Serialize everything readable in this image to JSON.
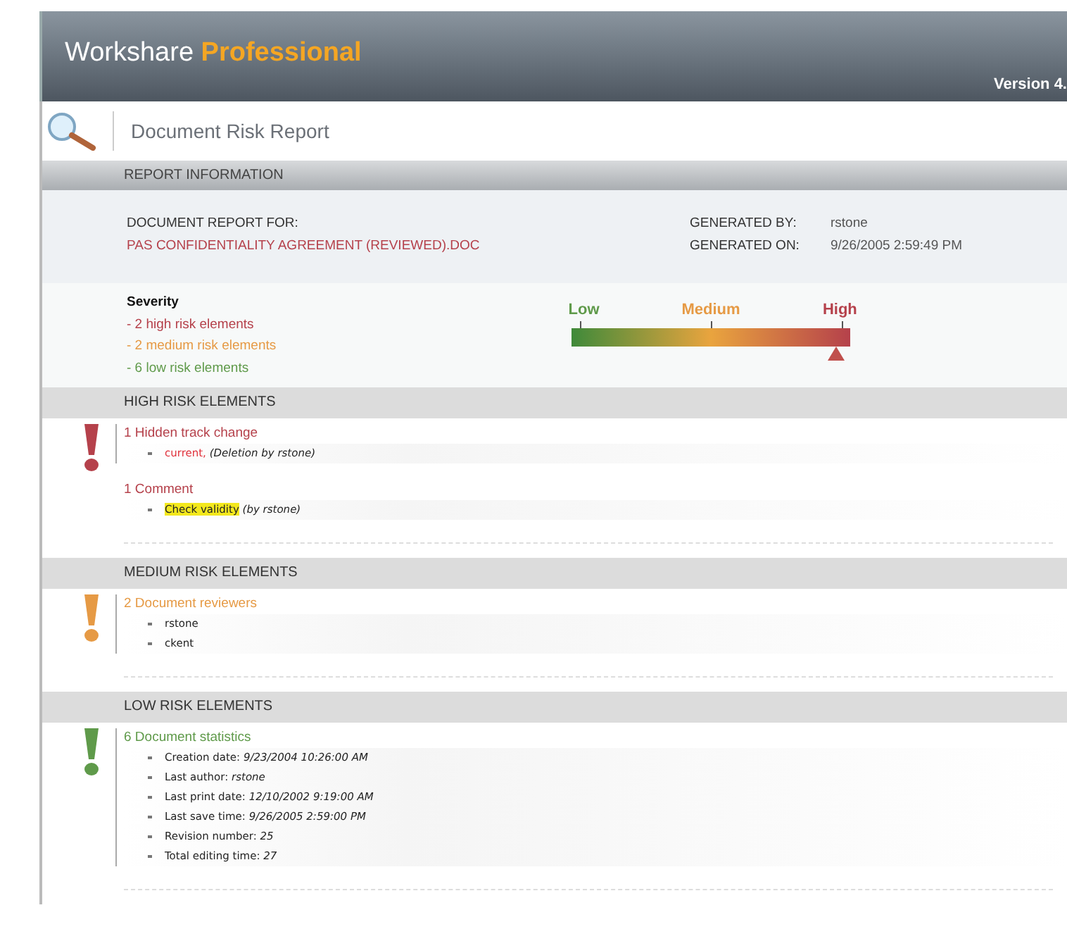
{
  "header": {
    "brand": "Workshare",
    "product": "Professional",
    "version": "Version 4."
  },
  "title": "Document Risk Report",
  "report_info": {
    "heading": "REPORT INFORMATION",
    "for_label": "DOCUMENT REPORT FOR:",
    "document": "PAS CONFIDENTIALITY AGREEMENT (REVIEWED).DOC",
    "by_label": "GENERATED BY:",
    "by": "rstone",
    "on_label": "GENERATED ON:",
    "on": "9/26/2005 2:59:49 PM"
  },
  "severity": {
    "heading": "Severity",
    "counts": [
      {
        "kind": "high",
        "text": "- 2 high risk elements"
      },
      {
        "kind": "medium",
        "text": "- 2 medium risk elements"
      },
      {
        "kind": "low",
        "text": "- 6 low risk elements"
      }
    ],
    "scale": [
      {
        "kind": "low",
        "label": "Low"
      },
      {
        "kind": "medium",
        "label": "Medium"
      },
      {
        "kind": "high",
        "label": "High"
      }
    ],
    "level": 0.95
  },
  "sections": [
    {
      "kind": "high",
      "heading": "HIGH RISK ELEMENTS",
      "groups": [
        {
          "title": "1 Hidden track change",
          "items": [
            {
              "kind": "deleted",
              "value": "current,",
              "note": "(Deletion by rstone)"
            }
          ]
        },
        {
          "title": "1 Comment",
          "items": [
            {
              "kind": "comment",
              "value": "Check validity",
              "note": "(by rstone)"
            }
          ]
        }
      ]
    },
    {
      "kind": "medium",
      "heading": "MEDIUM RISK ELEMENTS",
      "groups": [
        {
          "title": "2 Document reviewers",
          "items": [
            {
              "kind": "plain",
              "value": "rstone"
            },
            {
              "kind": "plain",
              "value": "ckent"
            }
          ]
        }
      ]
    },
    {
      "kind": "low",
      "heading": "LOW RISK ELEMENTS",
      "groups": [
        {
          "title": "6 Document statistics",
          "items": [
            {
              "kind": "stat",
              "label": "Creation date:",
              "value": "9/23/2004 10:26:00 AM"
            },
            {
              "kind": "stat",
              "label": "Last author:",
              "value": "rstone"
            },
            {
              "kind": "stat",
              "label": "Last print date:",
              "value": "12/10/2002 9:19:00 AM"
            },
            {
              "kind": "stat",
              "label": "Last save time:",
              "value": "9/26/2005 2:59:00 PM"
            },
            {
              "kind": "stat",
              "label": "Revision number:",
              "value": "25"
            },
            {
              "kind": "stat",
              "label": "Total editing time:",
              "value": "27"
            }
          ]
        }
      ]
    }
  ]
}
